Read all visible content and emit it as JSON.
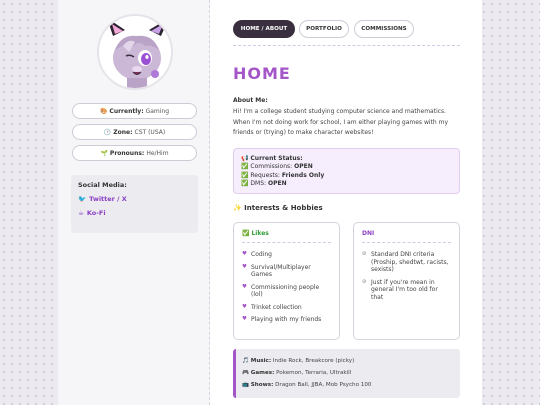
{
  "sidebar": {
    "pills": [
      {
        "icon": "🎨",
        "label": "Currently:",
        "value": "Gaming"
      },
      {
        "icon": "🕒",
        "label": "Zone:",
        "value": "CST (USA)"
      },
      {
        "icon": "🌱",
        "label": "Pronouns:",
        "value": "He/Him"
      }
    ],
    "social": {
      "heading": "Social Media:",
      "links": [
        {
          "icon": "🐦",
          "label": "Twitter / X"
        },
        {
          "icon": "☕",
          "label": "Ko-Fi"
        }
      ]
    }
  },
  "nav": {
    "items": [
      {
        "label": "HOME / ABOUT",
        "active": true
      },
      {
        "label": "PORTFOLIO",
        "active": false
      },
      {
        "label": "COMMISSIONS",
        "active": false
      }
    ]
  },
  "main": {
    "title": "HOME",
    "about_heading": "About Me:",
    "about_text": "Hi! I'm a college student studying computer science and mathematics. When I'm not doing work for school, I am either playing games with my friends or (trying) to make character websites!",
    "status": {
      "heading": "Current Status:",
      "heading_icon": "📢",
      "rows": [
        {
          "icon": "✅",
          "label": "Commissions:",
          "value": "OPEN"
        },
        {
          "icon": "✅",
          "label": "Requests:",
          "value": "Friends Only"
        },
        {
          "icon": "✅",
          "label": "DMS:",
          "value": "OPEN"
        }
      ]
    },
    "interests_heading": "✨ Interests & Hobbies",
    "likes": {
      "heading": "Likes",
      "heading_icon": "✅",
      "items": [
        "Coding",
        "Survival/Multiplayer Games",
        "Commissioning people (lol)",
        "Trinket collection",
        "Playing with my friends"
      ]
    },
    "dni": {
      "heading": "DNI",
      "items": [
        "Standard DNI criteria (Proship, shedtwt, racists, sexists)",
        "Just if you're mean in general I'm too old for that"
      ]
    },
    "media": [
      {
        "icon": "🎵",
        "label": "Music:",
        "value": "Indie Rock, Breakcore (picky)"
      },
      {
        "icon": "🎮",
        "label": "Games:",
        "value": "Pokemon, Terraria, Ultrakill"
      },
      {
        "icon": "📺",
        "label": "Shows:",
        "value": "Dragon Ball, JJBA, Mob Psycho 100"
      }
    ]
  },
  "colors": {
    "accent": "#a455c8",
    "nav_active": "#3a2f3e",
    "like_green": "#2f9e3a",
    "dni_purple": "#8a3fc4"
  }
}
